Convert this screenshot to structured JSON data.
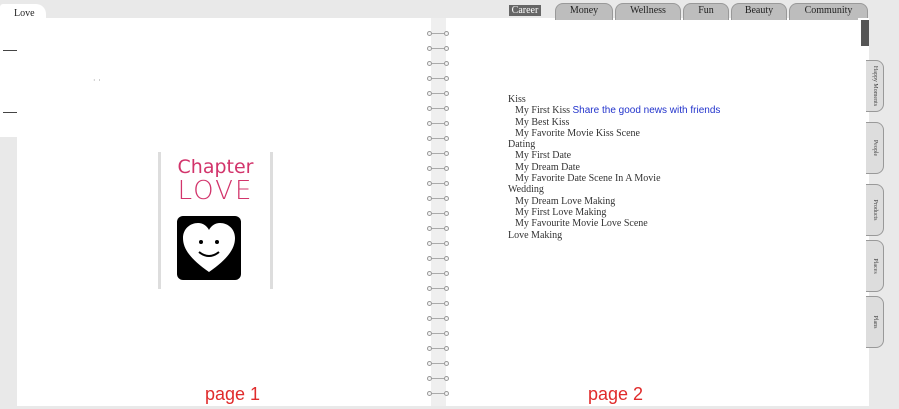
{
  "window": {
    "tab_label": "Love"
  },
  "top_tabs": [
    "Career",
    "Money",
    "Wellness",
    "Fun",
    "Beauty",
    "Community"
  ],
  "active_top_tab": "Career",
  "side_tabs": [
    "Happy Moments",
    "People",
    "Products",
    "Places",
    "Plans"
  ],
  "cover": {
    "title": "Chapter",
    "subtitle": "LOVE"
  },
  "pages": {
    "left_label": "page 1",
    "right_label": "page 2"
  },
  "toc": {
    "sections": [
      {
        "title": "Kiss",
        "items": [
          {
            "label": "My First Kiss",
            "share": "Share the good news with friends"
          },
          {
            "label": "My Best Kiss"
          },
          {
            "label": "My Favorite Movie Kiss Scene"
          }
        ]
      },
      {
        "title": "Dating",
        "items": [
          {
            "label": "My First Date"
          },
          {
            "label": "My Dream Date"
          },
          {
            "label": "My Favorite Date Scene In A Movie"
          }
        ]
      },
      {
        "title": "Wedding",
        "items": [
          {
            "label": "My Dream Love Making"
          },
          {
            "label": "My First Love Making"
          },
          {
            "label": "My Favourite Movie Love Scene"
          }
        ]
      },
      {
        "title": "Love Making",
        "items": []
      }
    ]
  },
  "colors": {
    "accent": "#d2346b",
    "page_label": "#e02b2b",
    "link": "#2233cc"
  }
}
